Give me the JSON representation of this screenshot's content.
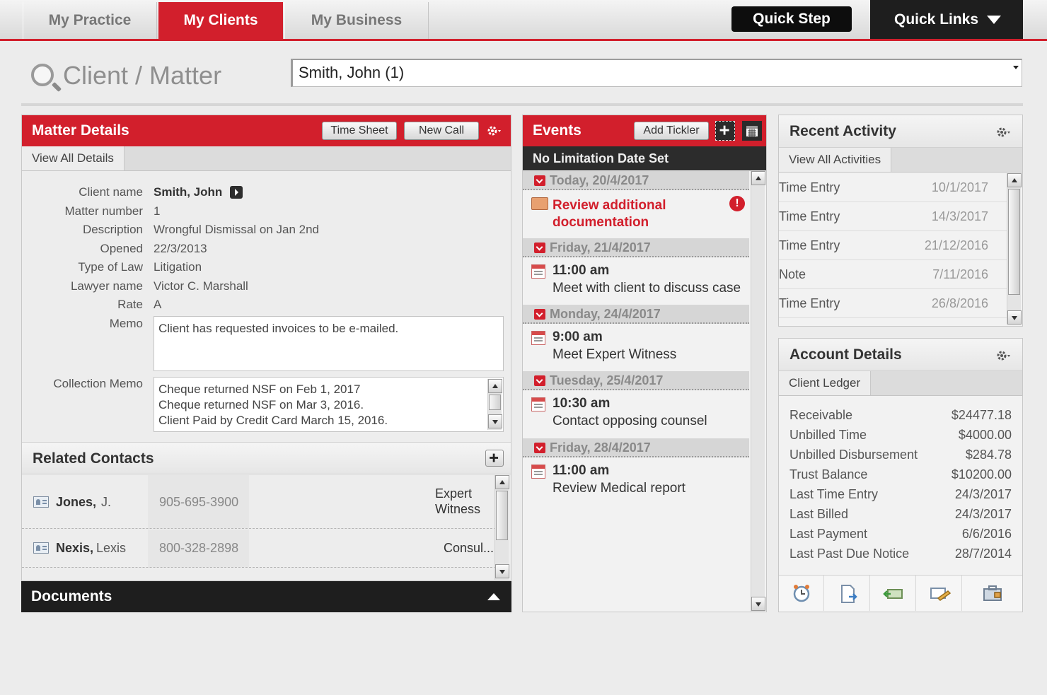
{
  "nav": {
    "tabs": [
      {
        "label": "My Practice",
        "active": false
      },
      {
        "label": "My Clients",
        "active": true
      },
      {
        "label": "My Business",
        "active": false
      }
    ],
    "quick_step": "Quick Step",
    "quick_links": "Quick Links"
  },
  "client_matter": {
    "label": "Client / Matter",
    "selected": "Smith, John (1)"
  },
  "matter_details": {
    "title": "Matter Details",
    "time_sheet": "Time Sheet",
    "new_call": "New Call",
    "view_all": "View All Details",
    "fields": {
      "client_name_label": "Client name",
      "client_name": "Smith, John",
      "matter_number_label": "Matter number",
      "matter_number": "1",
      "description_label": "Description",
      "description": "Wrongful Dismissal on Jan 2nd",
      "opened_label": "Opened",
      "opened": "22/3/2013",
      "type_of_law_label": "Type of Law",
      "type_of_law": "Litigation",
      "lawyer_label": "Lawyer name",
      "lawyer": "Victor C. Marshall",
      "rate_label": "Rate",
      "rate": "A",
      "memo_label": "Memo",
      "memo": "Client has requested invoices to be e-mailed.",
      "collection_memo_label": "Collection Memo",
      "collection_memo": [
        "Cheque returned NSF on Feb 1, 2017",
        "Cheque returned NSF on Mar 3, 2016.",
        "Client Paid by Credit Card March 15, 2016."
      ]
    }
  },
  "related_contacts": {
    "title": "Related Contacts",
    "rows": [
      {
        "name": "Jones,",
        "initial": "J.",
        "phone": "905-695-3900",
        "role": "Expert Witness"
      },
      {
        "name": "Nexis,",
        "initial": "Lexis",
        "phone": "800-328-2898",
        "role": "Consul..."
      }
    ]
  },
  "documents": {
    "title": "Documents"
  },
  "events": {
    "title": "Events",
    "add_tickler": "Add Tickler",
    "limitation": "No Limitation Date Set",
    "days": [
      {
        "date": "Today, 20/4/2017",
        "items": [
          {
            "time": "",
            "text": "Review additional documentation"
          }
        ]
      },
      {
        "date": "Friday, 21/4/2017",
        "items": [
          {
            "time": "11:00 am",
            "text": "Meet with client to discuss case"
          }
        ]
      },
      {
        "date": "Monday, 24/4/2017",
        "items": [
          {
            "time": "9:00 am",
            "text": "Meet Expert Witness"
          }
        ]
      },
      {
        "date": "Tuesday, 25/4/2017",
        "items": [
          {
            "time": "10:30 am",
            "text": "Contact opposing counsel"
          }
        ]
      },
      {
        "date": "Friday, 28/4/2017",
        "items": [
          {
            "time": "11:00 am",
            "text": "Review Medical report"
          }
        ]
      }
    ],
    "alert_color": "#d21f2c"
  },
  "recent_activity": {
    "title": "Recent Activity",
    "view_all": "View All Activities",
    "rows": [
      {
        "type": "Time Entry",
        "date": "10/1/2017"
      },
      {
        "type": "Time Entry",
        "date": "14/3/2017"
      },
      {
        "type": "Time Entry",
        "date": "21/12/2016"
      },
      {
        "type": "Note",
        "date": "7/11/2016"
      },
      {
        "type": "Time Entry",
        "date": "26/8/2016"
      }
    ]
  },
  "account_details": {
    "title": "Account Details",
    "ledger_tab": "Client Ledger",
    "rows": [
      {
        "label": "Receivable",
        "value": "$24477.18"
      },
      {
        "label": "Unbilled Time",
        "value": "$4000.00"
      },
      {
        "label": "Unbilled Disbursement",
        "value": "$284.78"
      },
      {
        "label": "Trust Balance",
        "value": "$10200.00"
      },
      {
        "label": "Last Time Entry",
        "value": "24/3/2017"
      },
      {
        "label": "Last Billed",
        "value": "24/3/2017"
      },
      {
        "label": "Last Payment",
        "value": "6/6/2016"
      },
      {
        "label": "Last Past Due Notice",
        "value": "28/7/2014"
      }
    ],
    "tools": [
      "alarm-clock-icon",
      "document-arrow-icon",
      "money-in-icon",
      "pencil-note-icon",
      "briefcase-lock-icon"
    ]
  },
  "colors": {
    "accent": "#d21f2c",
    "dark": "#1e1e1e"
  }
}
